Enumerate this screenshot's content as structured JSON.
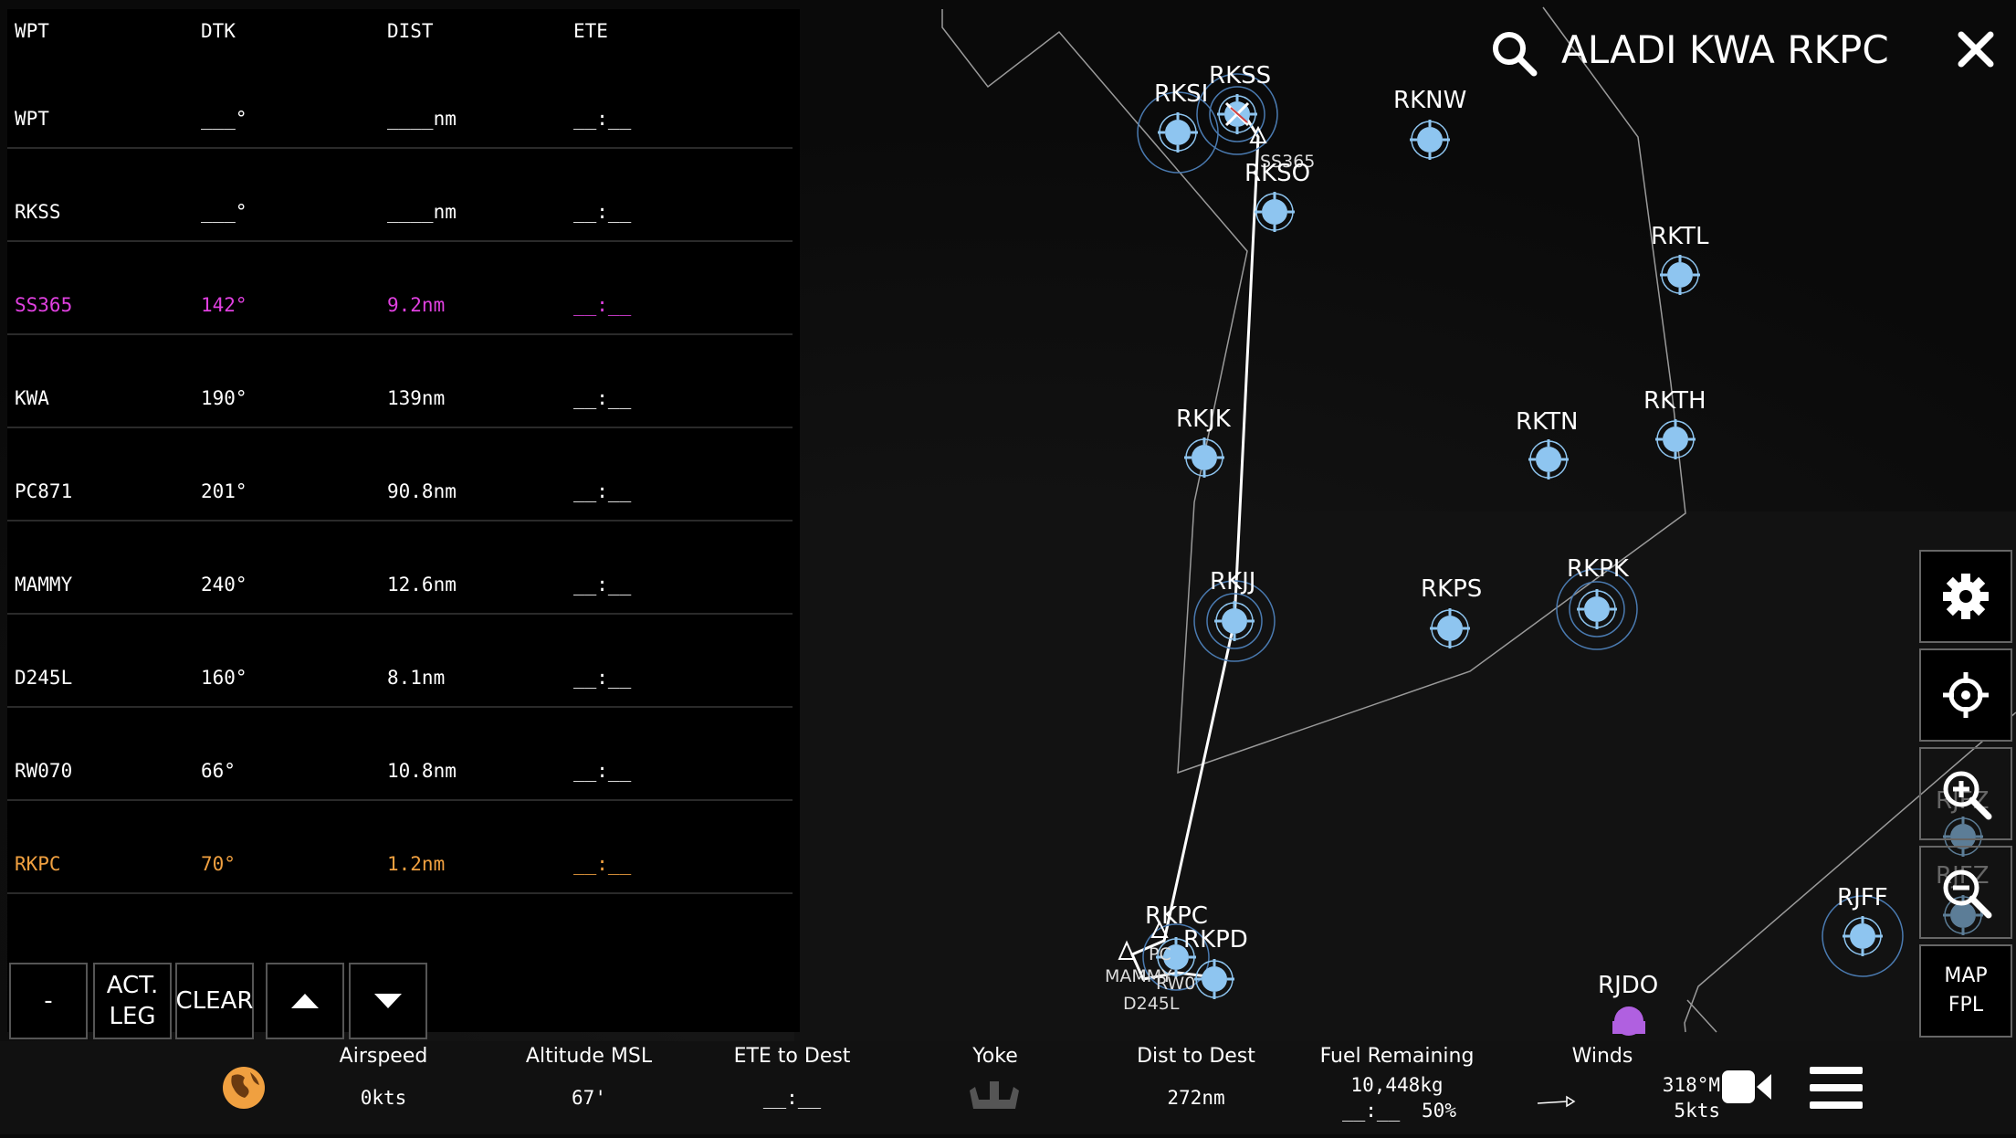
{
  "search": {
    "query": "ALADI KWA RKPC"
  },
  "fpl": {
    "headers": {
      "wpt": "WPT",
      "dtk": "DTK",
      "dist": "DIST",
      "ete": "ETE"
    },
    "rows": [
      {
        "wpt": "WPT",
        "dtk": "___°",
        "dist": "____nm",
        "ete": "__:__"
      },
      {
        "wpt": "RKSS",
        "dtk": "___°",
        "dist": "____nm",
        "ete": "__:__"
      },
      {
        "wpt": "SS365",
        "dtk": "142°",
        "dist": "9.2nm",
        "ete": "__:__"
      },
      {
        "wpt": "KWA",
        "dtk": "190°",
        "dist": "139nm",
        "ete": "__:__"
      },
      {
        "wpt": "PC871",
        "dtk": "201°",
        "dist": "90.8nm",
        "ete": "__:__"
      },
      {
        "wpt": "MAMMY",
        "dtk": "240°",
        "dist": "12.6nm",
        "ete": "__:__"
      },
      {
        "wpt": "D245L",
        "dtk": "160°",
        "dist": "8.1nm",
        "ete": "__:__"
      },
      {
        "wpt": "RW070",
        "dtk": "66°",
        "dist": "10.8nm",
        "ete": "__:__"
      },
      {
        "wpt": "RKPC",
        "dtk": "70°",
        "dist": "1.2nm",
        "ete": "__:__"
      }
    ],
    "buttons": {
      "minus": "-",
      "act_leg_1": "ACT.",
      "act_leg_2": "LEG",
      "clear": "CLEAR"
    }
  },
  "map": {
    "airports": {
      "rksi": "RKSI",
      "rkss": "RKSS",
      "rknw": "RKNW",
      "rkso": "RKSO",
      "rktl": "RKTL",
      "rkjk": "RKJK",
      "rktn": "RKTN",
      "rkth": "RKTH",
      "rkjj": "RKJJ",
      "rkps": "RKPS",
      "rkpk": "RKPK",
      "rkpc": "RKPC",
      "rkpd": "RKPD",
      "rjff": "RJFF",
      "rjdo": "RJDO",
      "rjfz": "RJFZ",
      "rjfz2": "RJFZ"
    },
    "waypoints": {
      "ss365": "SS365",
      "mammy": "MAMMY",
      "d245l": "D245L",
      "rw070": "RW0",
      "pc": "PC"
    }
  },
  "right_buttons": {
    "map": "MAP",
    "fpl": "FPL"
  },
  "bottom": {
    "airspeed_label": "Airspeed",
    "airspeed": "0kts",
    "altitude_label": "Altitude MSL",
    "altitude": "67'",
    "ete_label": "ETE to Dest",
    "ete": "__:__",
    "yoke_label": "Yoke",
    "dist_label": "Dist to Dest",
    "dist": "272nm",
    "fuel_label": "Fuel Remaining",
    "fuel": "10,448kg",
    "fuel_time": "__:__",
    "fuel_pct": "50%",
    "winds_label": "Winds",
    "winds_dir": "318°M",
    "winds_speed": "5kts"
  },
  "colors": {
    "active": "#e040e0",
    "destination": "#f0a040",
    "airport": "#8ec5f0"
  }
}
